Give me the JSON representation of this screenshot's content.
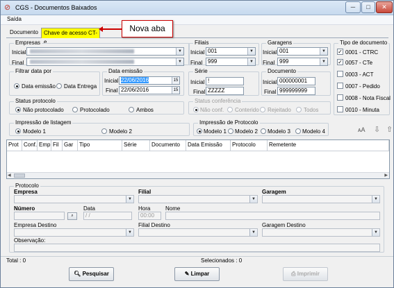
{
  "window": {
    "title": "CGS - Documentos Baixados",
    "minimize": "─",
    "maximize": "□",
    "close": "✕"
  },
  "menu": {
    "saida": "Saída"
  },
  "tabs": {
    "documento": "Documento",
    "chave": "Chave de acesso CT-e"
  },
  "callout": {
    "text": "Nova aba"
  },
  "empresas": {
    "title": "Empresas",
    "inicial_label": "Inicial",
    "final_label": "Final"
  },
  "filiais": {
    "title": "Filiais",
    "inicial_label": "Inicial",
    "inicial_value": "001",
    "final_label": "Final",
    "final_value": "999"
  },
  "garagens": {
    "title": "Garagens",
    "inicial_label": "Inicial",
    "inicial_value": "001",
    "final_label": "Final",
    "final_value": "999"
  },
  "tipo_documento": {
    "title": "Tipo de documento",
    "items": [
      {
        "label": "0001 - CTRC",
        "checked": true,
        "mark": "✓"
      },
      {
        "label": "0057 - CTe",
        "checked": true,
        "mark": "✓"
      },
      {
        "label": "0003 - ACT",
        "checked": false,
        "mark": ""
      },
      {
        "label": "0007 - Pedido",
        "checked": false,
        "mark": ""
      },
      {
        "label": "0008 - Nota Fiscal",
        "checked": false,
        "mark": ""
      },
      {
        "label": "0010 - Minuta",
        "checked": false,
        "mark": ""
      }
    ]
  },
  "filtrar_data": {
    "title": "Filtrar data por",
    "opt1": "Data emissão",
    "opt2": "Data Entrega",
    "selected": "Data emissão"
  },
  "data_emissao": {
    "title": "Data emissão",
    "inicial_label": "Inicial",
    "inicial_value": "22/06/2016",
    "final_label": "Final",
    "final_value": "22/06/2016",
    "cal_icon": "15"
  },
  "serie": {
    "title": "Série",
    "inicial_label": "Inicial",
    "inicial_value": "!",
    "final_label": "Final",
    "final_value": "ZZZZZ"
  },
  "documento": {
    "title": "Documento",
    "inicial_label": "Inicial",
    "inicial_value": "000000001",
    "final_label": "Final",
    "final_value": "999999999"
  },
  "status_protocolo": {
    "title": "Status protocolo",
    "opt1": "Não protocolado",
    "opt2": "Protocolado",
    "opt3": "Ambos"
  },
  "status_conferencia": {
    "title": "Status conferência",
    "opt1": "Não conf.",
    "opt2": "Conterido",
    "opt3": "Rejeitado",
    "opt4": "Todos"
  },
  "impressao_listagem": {
    "title": "Impressão de listagem",
    "opt1": "Modelo 1",
    "opt2": "Modelo 2"
  },
  "impressao_protocolo": {
    "title": "Impressão de Protocolo",
    "opt1": "Modelo 1",
    "opt2": "Modelo 2",
    "opt3": "Modelo 3",
    "opt4": "Modelo 4"
  },
  "tools": {
    "font_icon": "ᴀA",
    "down_icon": "⇩",
    "up_icon": "⇧"
  },
  "grid": {
    "columns": [
      "Prot",
      "Conf.",
      "Emp",
      "Fil",
      "Gar",
      "Tipo",
      "Série",
      "Documento",
      "Data Emissão",
      "Protocolo",
      "Remetente"
    ]
  },
  "protocolo": {
    "title": "Protocolo",
    "empresa": "Empresa",
    "filial": "Filial",
    "garagem": "Garagem",
    "numero": "Número",
    "data": "Data",
    "data_value": "/ /",
    "hora": "Hora",
    "hora_value": "00:00",
    "nome": "Nome",
    "empresa_destino": "Empresa Destino",
    "filial_destino": "Filial Destino",
    "garagem_destino": "Garagem Destino",
    "observacao": "Observação:"
  },
  "status": {
    "total": "Total : 0",
    "selecionados": "Selecionados : 0"
  },
  "buttons": {
    "pesquisar": "Pesquisar",
    "limpar": "Limpar",
    "imprimir": "Imprimir"
  }
}
